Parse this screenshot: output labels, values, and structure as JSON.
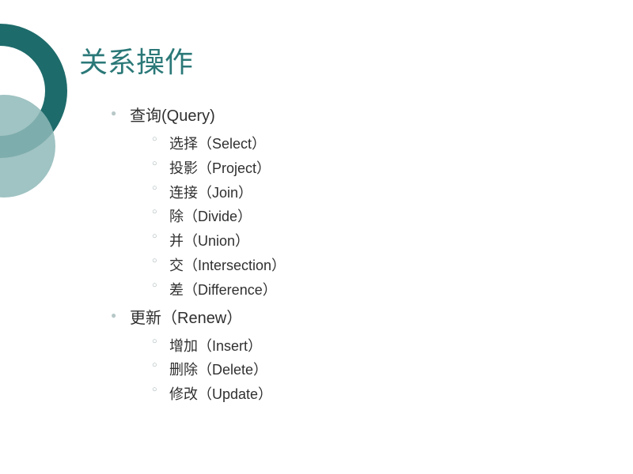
{
  "title": "关系操作",
  "sections": [
    {
      "label": "查询(Query)",
      "items": [
        "选择（Select）",
        "投影（Project）",
        "连接（Join）",
        "除（Divide）",
        "并（Union）",
        "交（Intersection）",
        "差（Difference）"
      ]
    },
    {
      "label": "更新（Renew）",
      "items": [
        "增加（Insert）",
        "删除（Delete）",
        "修改（Update）"
      ]
    }
  ]
}
